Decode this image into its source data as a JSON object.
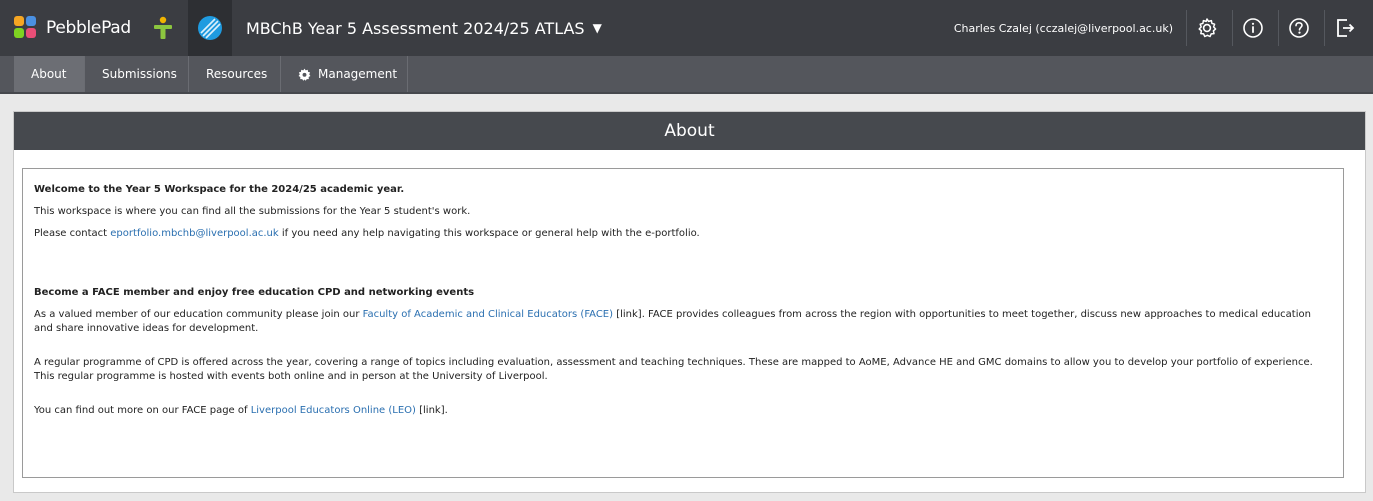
{
  "app": {
    "brand": "PebblePad",
    "workspace_title": "MBChB Year 5 Assessment 2024/25 ATLAS",
    "user": "Charles Czalej (cczalej@liverpool.ac.uk)"
  },
  "icons": [
    "settings-icon",
    "info-icon",
    "help-icon",
    "logout-icon"
  ],
  "colors": {
    "topbar": "#3b3d42",
    "navbar": "#54565c",
    "link": "#2a6fb0"
  },
  "tabs": [
    {
      "label": "About",
      "active": true
    },
    {
      "label": "Submissions"
    },
    {
      "label": "Resources"
    },
    {
      "label": "Management"
    }
  ],
  "panel": {
    "title": "About"
  },
  "content": {
    "welcome_heading": "Welcome to the Year 5 Workspace for the 2024/25 academic year.",
    "welcome_line": "This workspace is where you can find all the submissions for the Year 5 student's work.",
    "contact_pre": "Please contact ",
    "contact_email": "eportfolio.mbchb@liverpool.ac.uk",
    "contact_post": " if you need any help navigating this workspace or general help with the e-portfolio.",
    "face_heading": "Become a FACE member and enjoy free education CPD and networking events",
    "face_pre": "As a valued member of our education community please join our ",
    "face_link": "Faculty of Academic and Clinical Educators (FACE)",
    "face_post": " [link].  FACE provides colleagues from across the region with opportunities to meet together, discuss new approaches to medical education and share innovative ideas for development.",
    "cpd_text": "A regular programme of CPD is offered across the year, covering a range of topics including evaluation, assessment and teaching techniques. These are mapped to AoME, Advance HE and GMC domains to allow you to develop your portfolio of experience. This regular programme is hosted with events both online and in person at the University of Liverpool.",
    "leo_pre": "You can find out more on our FACE page of ",
    "leo_link": "Liverpool Educators Online (LEO)",
    "leo_post": " [link]."
  }
}
